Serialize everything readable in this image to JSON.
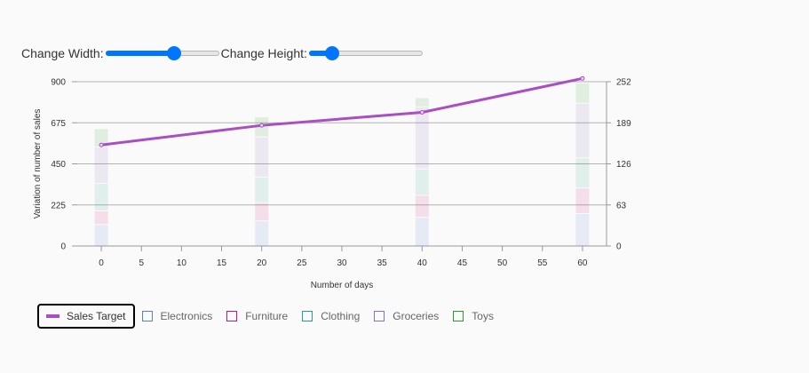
{
  "controls": {
    "width_label": "Change Width:",
    "width_value": 0.62,
    "height_label": "Change Height:",
    "height_value": 0.16
  },
  "colors": {
    "sales_target": "#a94ec3",
    "electronics": "#5b7dd6",
    "furniture": "#c2187c",
    "clothing": "#2a9b8a",
    "groceries": "#8a6fbf",
    "toys": "#2d9a2d"
  },
  "legend": [
    {
      "label": "Sales Target",
      "key": "sales_target",
      "kind": "line",
      "active": true
    },
    {
      "label": "Electronics",
      "key": "electronics",
      "kind": "box",
      "active": false
    },
    {
      "label": "Furniture",
      "key": "furniture",
      "kind": "box",
      "active": false
    },
    {
      "label": "Clothing",
      "key": "clothing",
      "kind": "box",
      "active": false
    },
    {
      "label": "Groceries",
      "key": "groceries",
      "kind": "box",
      "active": false
    },
    {
      "label": "Toys",
      "key": "toys",
      "kind": "box",
      "active": false
    }
  ],
  "chart_data": {
    "type": "bar",
    "stacked": true,
    "x": [
      0,
      20,
      40,
      60
    ],
    "xlabel": "Number of days",
    "ylabel": "Variation of number of sales",
    "xlim": [
      -3,
      63
    ],
    "xticks": [
      0,
      5,
      10,
      15,
      20,
      25,
      30,
      35,
      40,
      45,
      50,
      55,
      60
    ],
    "ylim": [
      0,
      900
    ],
    "yticks": [
      0,
      225,
      450,
      675,
      900
    ],
    "y2lim": [
      0,
      252
    ],
    "y2ticks": [
      0,
      63,
      126,
      189,
      252
    ],
    "grid": true,
    "series": [
      {
        "name": "Electronics",
        "key": "electronics",
        "values": [
          120,
          140,
          160,
          180
        ]
      },
      {
        "name": "Furniture",
        "key": "furniture",
        "values": [
          75,
          100,
          120,
          140
        ]
      },
      {
        "name": "Clothing",
        "key": "clothing",
        "values": [
          150,
          140,
          145,
          165
        ]
      },
      {
        "name": "Groceries",
        "key": "groceries",
        "values": [
          200,
          220,
          340,
          300
        ]
      },
      {
        "name": "Toys",
        "key": "toys",
        "values": [
          100,
          110,
          50,
          110
        ]
      }
    ],
    "line": {
      "name": "Sales Target",
      "key": "sales_target",
      "axis": "right",
      "values": [
        155,
        185,
        205,
        257
      ]
    }
  }
}
